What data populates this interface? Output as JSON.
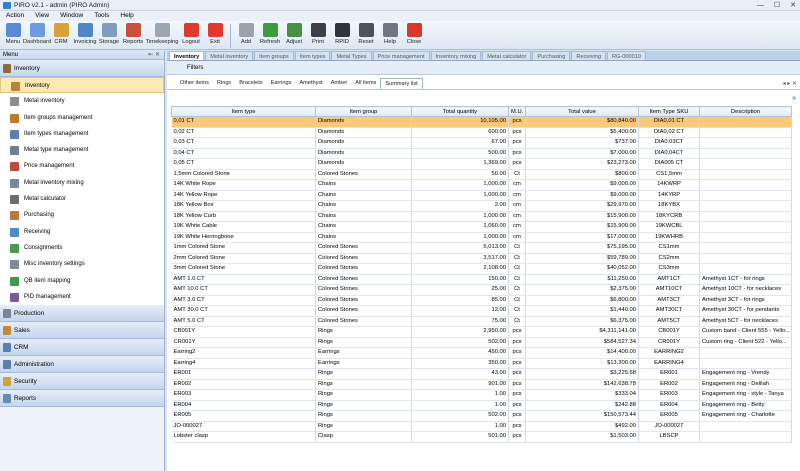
{
  "app": {
    "title": "PIRO v2.1 - admin (PIRO Admin)"
  },
  "menu": [
    "Action",
    "View",
    "Window",
    "Tools",
    "Help"
  ],
  "toolbar": [
    {
      "label": "Menu",
      "color": "#5a8ad6"
    },
    {
      "label": "Dashboard",
      "color": "#6b9be0"
    },
    {
      "label": "CRM",
      "color": "#d7a23a"
    },
    {
      "label": "Invoicing",
      "color": "#4f87c6"
    },
    {
      "label": "Storage",
      "color": "#7f9dbf"
    },
    {
      "label": "Reports",
      "color": "#c8503c"
    },
    {
      "label": "Timekeeping",
      "color": "#9aa6b3"
    },
    {
      "label": "Logout",
      "color": "#e03a2f"
    },
    {
      "label": "Exit",
      "color": "#e03a2f"
    },
    {
      "label": "Add",
      "color": "#9aa3ad"
    },
    {
      "label": "Refresh",
      "color": "#3a9c3c"
    },
    {
      "label": "Adjust",
      "color": "#4a8f46"
    },
    {
      "label": "Print",
      "color": "#3a3f48"
    },
    {
      "label": "RPID",
      "color": "#2f3540"
    },
    {
      "label": "Reset",
      "color": "#4c525c"
    },
    {
      "label": "Help",
      "color": "#6d7682"
    },
    {
      "label": "Close",
      "color": "#d8372c"
    }
  ],
  "sidebar": {
    "header": "Menu",
    "pin": "⇤ ✕",
    "groups_top": [
      {
        "label": "Inventory",
        "color": "#8c6b3a"
      }
    ],
    "items": [
      {
        "label": "Inventory",
        "color": "#b8843a"
      },
      {
        "label": "Metal inventory",
        "color": "#8c8c8c"
      },
      {
        "label": "Item groups management",
        "color": "#c07a2a"
      },
      {
        "label": "Item types management",
        "color": "#5a7fb0"
      },
      {
        "label": "Metal type management",
        "color": "#6d7e93"
      },
      {
        "label": "Price management",
        "color": "#c04a3a"
      },
      {
        "label": "Metal inventory mixing",
        "color": "#7a8796"
      },
      {
        "label": "Metal calculator",
        "color": "#6c6c6c"
      },
      {
        "label": "Purchasing",
        "color": "#b87a3a"
      },
      {
        "label": "Receiving",
        "color": "#4f8bd0"
      },
      {
        "label": "Consignments",
        "color": "#4b9a4b"
      },
      {
        "label": "Misc inventory settings",
        "color": "#7f8a96"
      },
      {
        "label": "QB item mapping",
        "color": "#3c9c4a"
      },
      {
        "label": "PID management",
        "color": "#7a5aa0"
      }
    ],
    "groups_bottom": [
      {
        "label": "Production",
        "color": "#7a8796"
      },
      {
        "label": "Sales",
        "color": "#c08a3a"
      },
      {
        "label": "CRM",
        "color": "#5a7fb0"
      },
      {
        "label": "Administration",
        "color": "#5a7fb0"
      },
      {
        "label": "Security",
        "color": "#d0a23a"
      },
      {
        "label": "Reports",
        "color": "#6c8ab0"
      }
    ]
  },
  "tabs": [
    "Inventory",
    "Metal inventory",
    "Item groups",
    "Item types",
    "Metal Types",
    "Price management",
    "Inventory mixing",
    "Metal calculator",
    "Purchasing",
    "Receiving",
    "RG-000010"
  ],
  "filters_label": "Filters",
  "subtabs": [
    "Other items",
    "Rings",
    "Bracelets",
    "Earrings",
    "Amethyst",
    "Amber",
    "All items",
    "Summary list"
  ],
  "subnav": "◂ ▸ ✕",
  "expand": "»",
  "grid": {
    "columns": [
      "Item type",
      "Item group",
      "Total quantity",
      "M.U.",
      "Total value",
      "Item Type SKU",
      "Description"
    ],
    "rows": [
      [
        "0,01 CT",
        "Diamonds",
        "10,105.00",
        "pcs",
        "$80,840.00",
        "DIA0,01 CT",
        ""
      ],
      [
        "0,02 CT",
        "Diamonds",
        "600.00",
        "pcs",
        "$5,400.00",
        "DIA0,02 CT",
        ""
      ],
      [
        "0,03 CT",
        "Diamonds",
        "67.00",
        "pcs",
        "$737.00",
        "DIA0.03CT",
        ""
      ],
      [
        "0,04 CT",
        "Diamonds",
        "500.00",
        "pcs",
        "$7,000.00",
        "DIA0,04CT",
        ""
      ],
      [
        "0,05 CT",
        "Diamonds",
        "1,369.00",
        "pcs",
        "$23,273.00",
        "DIA005 CT",
        ""
      ],
      [
        "1,5mm Colored Stone",
        "Colored Stones",
        "50.00",
        "Ct",
        "$800.00",
        "CS1,5mm",
        ""
      ],
      [
        "14K White Rope",
        "Chains",
        "1,000.00",
        "cm",
        "$9,000.00",
        "14KWRP",
        ""
      ],
      [
        "14K Yellow Rope",
        "Chains",
        "1,000.00",
        "cm",
        "$9,000.00",
        "14KYRP",
        ""
      ],
      [
        "18K Yellow Box",
        "Chains",
        "2.00",
        "cm",
        "$29,970.00",
        "18KYBX",
        ""
      ],
      [
        "18K Yellow Curb",
        "Chains",
        "1,000.00",
        "cm",
        "$15,900.00",
        "18KYCRB",
        ""
      ],
      [
        "19K White Cable",
        "Chains",
        "1,060.00",
        "cm",
        "$15,900.00",
        "19KWCBL",
        ""
      ],
      [
        "19K White Herringbone",
        "Chains",
        "1,000.00",
        "cm",
        "$17,000.00",
        "19KWHRB",
        ""
      ],
      [
        "1mm Colored Stone",
        "Colored Stones",
        "5,013.00",
        "Ct",
        "$75,195.00",
        "CS1mm",
        ""
      ],
      [
        "2mm Colored Stone",
        "Colored Stones",
        "3,517.00",
        "Ct",
        "$59,789.00",
        "CS2mm",
        ""
      ],
      [
        "3mm Colored Stone",
        "Colored Stones",
        "2,108.00",
        "Ct",
        "$40,052.00",
        "CS3mm",
        ""
      ],
      [
        "AMT 1.0 CT",
        "Colored Stones",
        "150.00",
        "Ct",
        "$11,250.00",
        "AMT1CT",
        "Amethyst 1CT - for rings"
      ],
      [
        "AMT 10.0 CT",
        "Colored Stones",
        "25.00",
        "Ct",
        "$2,375.00",
        "AMT10CT",
        "Amethyst 10CT - for necklaces"
      ],
      [
        "AMT 3.0 CT",
        "Colored Stones",
        "85.00",
        "Ct",
        "$6,800.00",
        "AMT3CT",
        "Amethyst 3CT - for rings"
      ],
      [
        "AMT 30.0 CT",
        "Colored Stones",
        "12.00",
        "Ct",
        "$1,440.00",
        "AMT30CT",
        "Amethyst 30CT - for pendants"
      ],
      [
        "AMT 5.0 CT",
        "Colored Stones",
        "75.00",
        "Ct",
        "$6,375.00",
        "AMT5CT",
        "Amethyst 5CT - for necklaces"
      ],
      [
        "CB001Y",
        "Rings",
        "2,950.00",
        "pcs",
        "$4,311,141.00",
        "CB001Y",
        "Custom band - Client 555 - Yello..."
      ],
      [
        "CR001Y",
        "Rings",
        "502.00",
        "pcs",
        "$584,527.34",
        "CR001Y",
        "Custom ring - Client 522 - Yello..."
      ],
      [
        "Earring2",
        "Earrings",
        "450.00",
        "pcs",
        "$14,400.00",
        "EARRING2",
        ""
      ],
      [
        "Earring4",
        "Earrings",
        "350.00",
        "pcs",
        "$13,300.00",
        "EARRING4",
        ""
      ],
      [
        "ER001",
        "Rings",
        "43.00",
        "pcs",
        "$3,225.68",
        "ER001",
        "Engagement ring - Vrendy"
      ],
      [
        "ER002",
        "Rings",
        "901.00",
        "pcs",
        "$142,638.78",
        "ER002",
        "Engagement ring - Delilah"
      ],
      [
        "ER003",
        "Rings",
        "1.00",
        "pcs",
        "$333.04",
        "ER003",
        "Engagement ring - style - Tanya"
      ],
      [
        "ER004",
        "Rings",
        "1.00",
        "pcs",
        "$242.88",
        "ER004",
        "Engagement ring - Betty"
      ],
      [
        "ER005",
        "Rings",
        "502.00",
        "pcs",
        "$150,573.44",
        "ER005",
        "Engagement ring - Charlotte"
      ],
      [
        "JO-000027",
        "Rings",
        "1.00",
        "pcs",
        "$492.00",
        "JO-000027",
        ""
      ],
      [
        "Lobster clasp",
        "Clasp",
        "501.00",
        "pcs",
        "$1,503.00",
        "LBSCP",
        ""
      ]
    ]
  }
}
